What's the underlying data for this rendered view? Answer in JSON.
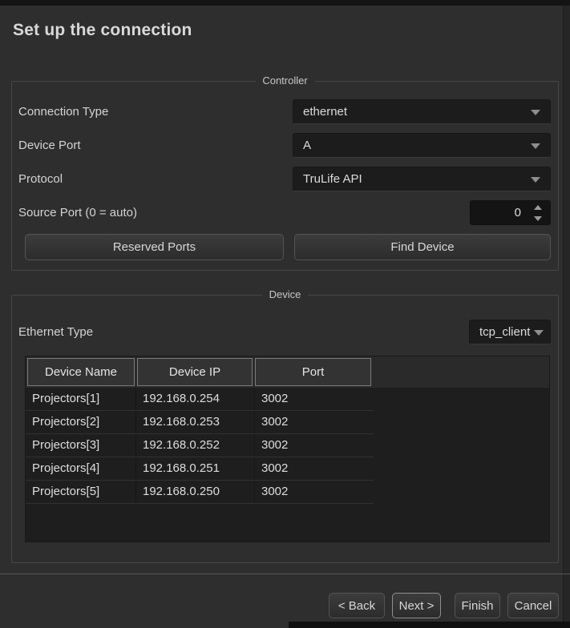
{
  "window": {
    "title": "Set up the connection"
  },
  "controller": {
    "legend": "Controller",
    "fields": [
      {
        "label": "Connection Type",
        "value": "ethernet"
      },
      {
        "label": "Device Port",
        "value": "A"
      },
      {
        "label": "Protocol",
        "value": "TruLife API"
      },
      {
        "label": "Source Port (0 = auto)",
        "value": "0"
      }
    ],
    "buttons": {
      "reserved_ports": "Reserved Ports",
      "find_device": "Find Device"
    }
  },
  "device": {
    "legend": "Device",
    "ethernet_type": {
      "label": "Ethernet Type",
      "value": "tcp_client"
    },
    "table": {
      "columns": [
        "Device Name",
        "Device IP",
        "Port"
      ],
      "rows": [
        [
          "Projectors[1]",
          "192.168.0.254",
          "3002"
        ],
        [
          "Projectors[2]",
          "192.168.0.253",
          "3002"
        ],
        [
          "Projectors[3]",
          "192.168.0.252",
          "3002"
        ],
        [
          "Projectors[4]",
          "192.168.0.251",
          "3002"
        ],
        [
          "Projectors[5]",
          "192.168.0.250",
          "3002"
        ]
      ]
    }
  },
  "footer": {
    "back": "< Back",
    "next": "Next >",
    "finish": "Finish",
    "cancel": "Cancel"
  },
  "colors": {
    "background": "#2e2e2e",
    "control_background": "#1c1c1c",
    "text": "#d4d4d4",
    "group_border": "#474747",
    "table_header_border": "#7b7b7b",
    "button_border": "#545454",
    "focused_button_border": "#8f8f8f"
  }
}
